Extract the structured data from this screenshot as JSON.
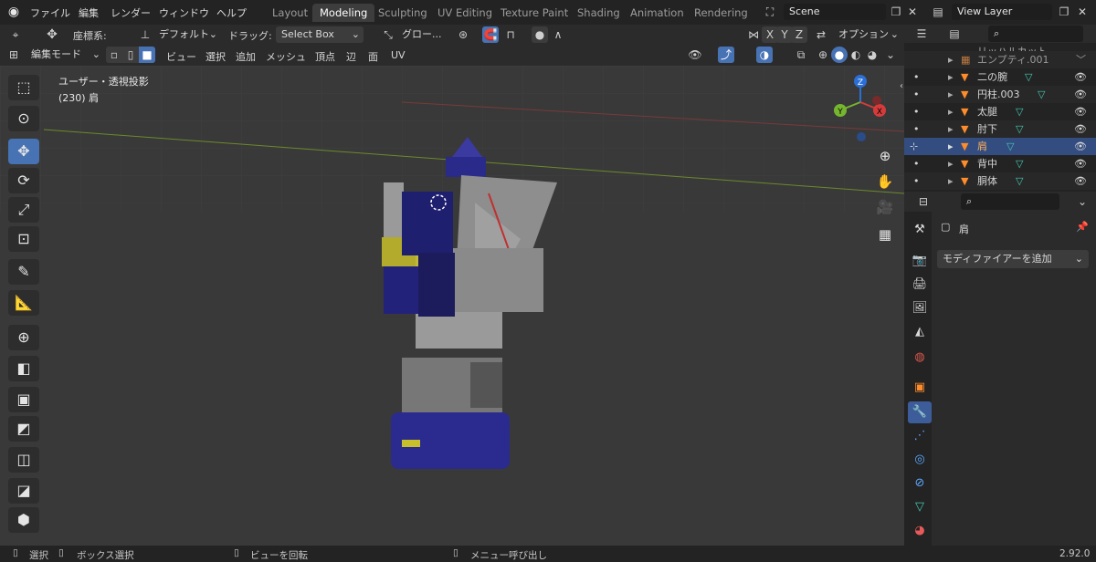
{
  "menubar": {
    "items": [
      "ファイル",
      "編集",
      "レンダー",
      "ウィンドウ",
      "ヘルプ"
    ],
    "workspaces": [
      "Layout",
      "Modeling",
      "Sculpting",
      "UV Editing",
      "Texture Paint",
      "Shading",
      "Animation",
      "Rendering"
    ],
    "active_workspace": "Modeling",
    "scene": "Scene",
    "view_layer": "View Layer"
  },
  "tool_header": {
    "orientation_label": "座標系:",
    "orientation_value": "デフォルト",
    "drag_label": "ドラッグ:",
    "drag_value": "Select Box",
    "pivot_value": "グロー...",
    "axis_x": "X",
    "axis_y": "Y",
    "axis_z": "Z",
    "options": "オプション"
  },
  "editor_header": {
    "mode": "編集モード",
    "menus": [
      "ビュー",
      "選択",
      "追加",
      "メッシュ",
      "頂点",
      "辺",
      "面",
      "UV"
    ]
  },
  "viewport": {
    "view_name": "ユーザー・透視投影",
    "object_info": "(230) 肩",
    "gizmo_x": "X",
    "gizmo_y": "Y",
    "gizmo_z": "Z"
  },
  "outliner": {
    "rows": [
      {
        "name": "リッハルカット"
      },
      {
        "name": "エンプティ.001"
      },
      {
        "name": "二の腕"
      },
      {
        "name": "円柱.003"
      },
      {
        "name": "太腿"
      },
      {
        "name": "肘下"
      },
      {
        "name": "肩"
      },
      {
        "name": "背中"
      },
      {
        "name": "胴体"
      }
    ],
    "selected_index": 6
  },
  "properties": {
    "object_name": "肩",
    "add_modifier": "モディファイアーを追加"
  },
  "statusbar": {
    "select": "選択",
    "box_select": "ボックス選択",
    "rotate_view": "ビューを回転",
    "call_menu": "メニュー呼び出し",
    "version": "2.92.0"
  },
  "colors": {
    "accent": "#4772b3",
    "mesh_icon": "#ff8c2a",
    "modifier_icon": "#45c8b1",
    "object_body": "#8e8e8e",
    "object_blue": "#1c1c8c"
  }
}
